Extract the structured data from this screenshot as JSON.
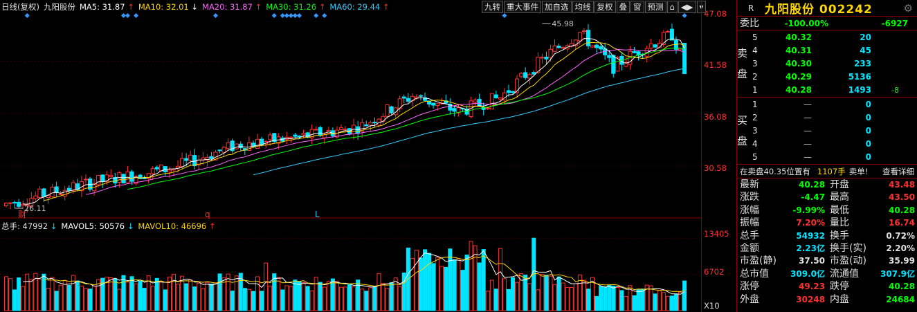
{
  "main_legend": {
    "mode": "日线(复权)",
    "name": "九阳股份",
    "ma5": "MA5: 31.87",
    "ma10": "MA10: 32.01",
    "ma20": "MA20: 31.87",
    "ma30": "MA30: 31.26",
    "ma60": "MA60: 29.44",
    "ma5_arrow": "↑",
    "ma10_arrow": "↓",
    "ma20_arrow": "↑",
    "ma30_arrow": "↑",
    "ma60_arrow": "↑"
  },
  "toolbar": [
    "九转",
    "重大事件",
    "加自选",
    "均线",
    "复权",
    "叠",
    "窗",
    "预测",
    "⌂",
    "◀▶",
    "▾"
  ],
  "price_axis": [
    "47.08",
    "41.58",
    "36.08",
    "30.58"
  ],
  "volume_axis": [
    "13405",
    "6702",
    "X10"
  ],
  "chart_marks": {
    "high": "45.98",
    "low": "26.11",
    "event_cai": "财",
    "event_q": "q",
    "event_l": "L"
  },
  "volume_legend": {
    "total": "总手: 47992",
    "total_arrow": "↓",
    "mavol5": "MAVOL5: 50576",
    "mavol5_arrow": "↓",
    "mavol10": "MAVOL10: 46696",
    "mavol10_arrow": "↑"
  },
  "colors": {
    "up": "#ff3030",
    "down": "#00e5ff",
    "ma5": "#ffffff",
    "ma10": "#ffd700",
    "ma20": "#ff66ff",
    "ma30": "#00ff00",
    "ma60": "#33ccff",
    "accent_border": "#8b0000"
  },
  "chart_data": {
    "type": "candlestick",
    "price_axis_ticks": [
      47.08,
      41.58,
      36.08,
      30.58
    ],
    "high": 45.98,
    "low": 26.11,
    "last_close": 40.28,
    "volume_axis_ticks": [
      13405,
      6702
    ],
    "volume_unit": "X10"
  },
  "quote": {
    "flag": "R",
    "title": "九阳股份 002242",
    "weibi_label": "委比",
    "weibi_pct": "-100.00%",
    "weibi_diff": "-6927",
    "sell_label": "卖盘",
    "buy_label": "买盘",
    "sell": [
      {
        "n": "5",
        "p": "40.32",
        "v": "20",
        "c": ""
      },
      {
        "n": "4",
        "p": "40.31",
        "v": "45",
        "c": ""
      },
      {
        "n": "3",
        "p": "40.30",
        "v": "233",
        "c": ""
      },
      {
        "n": "2",
        "p": "40.29",
        "v": "5136",
        "c": ""
      },
      {
        "n": "1",
        "p": "40.28",
        "v": "1493",
        "c": "-8"
      }
    ],
    "buy": [
      {
        "n": "1",
        "p": "—",
        "v": "0"
      },
      {
        "n": "2",
        "p": "—",
        "v": "0"
      },
      {
        "n": "3",
        "p": "—",
        "v": "0"
      },
      {
        "n": "4",
        "p": "—",
        "v": "0"
      },
      {
        "n": "5",
        "p": "—",
        "v": "0"
      }
    ],
    "notice": {
      "text": "在卖盘40.35位置有",
      "qty": "1107手",
      "action": "卖单!",
      "detail": "查看详细"
    },
    "stats": [
      {
        "k": "最新",
        "v": "40.28",
        "vc": "c-green",
        "k2": "开盘",
        "v2": "43.48",
        "v2c": "c-red"
      },
      {
        "k": "涨跌",
        "v": "-4.47",
        "vc": "c-green",
        "k2": "最高",
        "v2": "43.50",
        "v2c": "c-red"
      },
      {
        "k": "涨幅",
        "v": "-9.99%",
        "vc": "c-green",
        "k2": "最低",
        "v2": "40.28",
        "v2c": "c-green"
      },
      {
        "k": "振幅",
        "v": "7.20%",
        "vc": "c-red",
        "k2": "量比",
        "v2": "16.74",
        "v2c": "c-red"
      },
      {
        "k": "总手",
        "v": "54932",
        "vc": "c-cyan",
        "k2": "换手",
        "v2": "0.72%",
        "v2c": "c-white"
      },
      {
        "k": "金额",
        "v": "2.23亿",
        "vc": "c-cyan",
        "k2": "换手(实)",
        "v2": "2.20%",
        "v2c": "c-white"
      },
      {
        "k": "市盈(静)",
        "v": "37.50",
        "vc": "c-white",
        "k2": "市盈(动)",
        "v2": "35.99",
        "v2c": "c-white"
      },
      {
        "k": "总市值",
        "v": "309.0亿",
        "vc": "c-cyan",
        "k2": "流通值",
        "v2": "307.9亿",
        "v2c": "c-cyan"
      },
      {
        "k": "涨停",
        "v": "49.23",
        "vc": "c-red",
        "k2": "跌停",
        "v2": "40.28",
        "v2c": "c-green"
      },
      {
        "k": "外盘",
        "v": "30248",
        "vc": "c-red",
        "k2": "内盘",
        "v2": "24684",
        "v2c": "c-green"
      }
    ]
  }
}
